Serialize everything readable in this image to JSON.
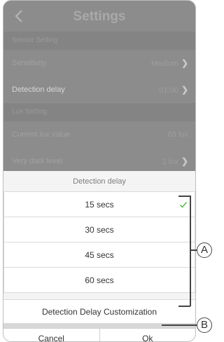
{
  "header": {
    "title": "Settings",
    "back_icon": "chevron-left-icon"
  },
  "settings": {
    "sections": [
      {
        "title": "Sensor Setting",
        "rows": [
          {
            "label": "Sensitivity",
            "value": "Medium"
          },
          {
            "label": "Detection delay",
            "value": "01:00"
          }
        ]
      },
      {
        "title": "Lux Setting",
        "rows": [
          {
            "label": "Current lux value",
            "value": "85 lux"
          },
          {
            "label": "Very dark level",
            "value": "1 lux"
          }
        ]
      }
    ]
  },
  "sheet": {
    "title": "Detection delay",
    "options": [
      {
        "label": "15 secs",
        "selected": true
      },
      {
        "label": "30 secs",
        "selected": false
      },
      {
        "label": "45 secs",
        "selected": false
      },
      {
        "label": "60 secs",
        "selected": false
      }
    ],
    "customize_label": "Detection Delay Customization",
    "cancel_label": "Cancel",
    "ok_label": "Ok"
  },
  "callouts": {
    "a": "A",
    "b": "B"
  },
  "colors": {
    "accent_check": "#3dae2b",
    "overlay": "#8c8c8c"
  }
}
